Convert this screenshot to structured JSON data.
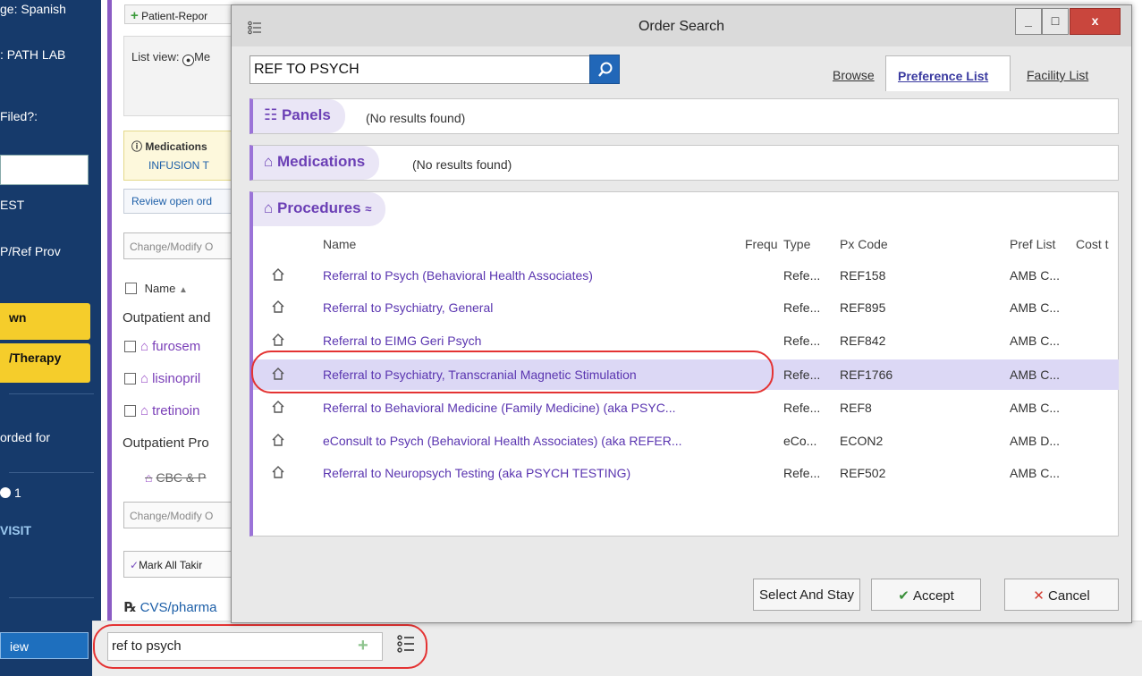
{
  "sidebar": {
    "items": [
      {
        "label": "ge: Spanish"
      },
      {
        "label": ": PATH LAB"
      },
      {
        "label": " Filed?:"
      },
      {
        "label": "EST"
      },
      {
        "label": "P/Ref Prov"
      },
      {
        "label": "wn"
      },
      {
        "label": "/Therapy"
      },
      {
        "label": "orded for"
      },
      {
        "label": "1"
      },
      {
        "label": " VISIT"
      },
      {
        "label": "iew"
      }
    ]
  },
  "background": {
    "tag_label": "Patient-Repor",
    "list_view_label": "List view:",
    "list_view_option": "Me",
    "med_notice_title": "Medications",
    "med_notice_link": "INFUSION T",
    "review_link": "Review open ord",
    "change_modify_1": "Change/Modify O",
    "name_col": "Name",
    "group_outpatient": "Outpatient and",
    "med_items": [
      "furosem",
      "lisinopril",
      "tretinoin"
    ],
    "group_outpatient_pro": "Outpatient Pro",
    "proc_item": "CBC & P",
    "change_modify_2": "Change/Modify O",
    "mark_all": "Mark All Takir",
    "pharmacy": "CVS/pharma"
  },
  "quick_order": {
    "value": "ref to psych"
  },
  "dialog": {
    "title": "Order Search",
    "window_buttons": {
      "minimize": "_",
      "maximize": "□",
      "close": "x"
    },
    "search_value": "REF TO PSYCH",
    "tabs": [
      {
        "label": "Browse"
      },
      {
        "label": "Preference List"
      },
      {
        "label": "Facility List"
      }
    ],
    "panels": {
      "title": "Panels",
      "note": "(No results found)"
    },
    "medications": {
      "title": "Medications",
      "note": "(No results found)"
    },
    "procedures": {
      "title": "Procedures",
      "columns": [
        "Name",
        "Frequ",
        "Type",
        "Px Code",
        "Pref List",
        "Cost t"
      ],
      "rows": [
        {
          "name": "Referral to Psych (Behavioral Health Associates)",
          "type": "Refe...",
          "code": "REF158",
          "pref": "AMB C..."
        },
        {
          "name": "Referral to Psychiatry, General",
          "type": "Refe...",
          "code": "REF895",
          "pref": "AMB C..."
        },
        {
          "name": "Referral to EIMG Geri Psych",
          "type": "Refe...",
          "code": "REF842",
          "pref": "AMB C..."
        },
        {
          "name": "Referral to Psychiatry, Transcranial Magnetic Stimulation",
          "type": "Refe...",
          "code": "REF1766",
          "pref": "AMB C..."
        },
        {
          "name": "Referral to Behavioral Medicine (Family Medicine) (aka PSYC...",
          "type": "Refe...",
          "code": "REF8",
          "pref": "AMB C..."
        },
        {
          "name": "eConsult to Psych (Behavioral Health Associates) (aka REFER...",
          "type": "eCo...",
          "code": "ECON2",
          "pref": "AMB D..."
        },
        {
          "name": "Referral to Neuropsych Testing (aka PSYCH TESTING)",
          "type": "Refe...",
          "code": "REF502",
          "pref": "AMB C..."
        }
      ]
    },
    "buttons": {
      "select_and_stay": "Select And Stay",
      "accept": "Accept",
      "cancel": "Cancel"
    }
  },
  "colors": {
    "sidebar": "#163a6b",
    "accent_purple": "#9b73d8",
    "selected_row": "#dcd8f5",
    "search_button": "#2167b8",
    "highlight_oval": "#e43333"
  }
}
